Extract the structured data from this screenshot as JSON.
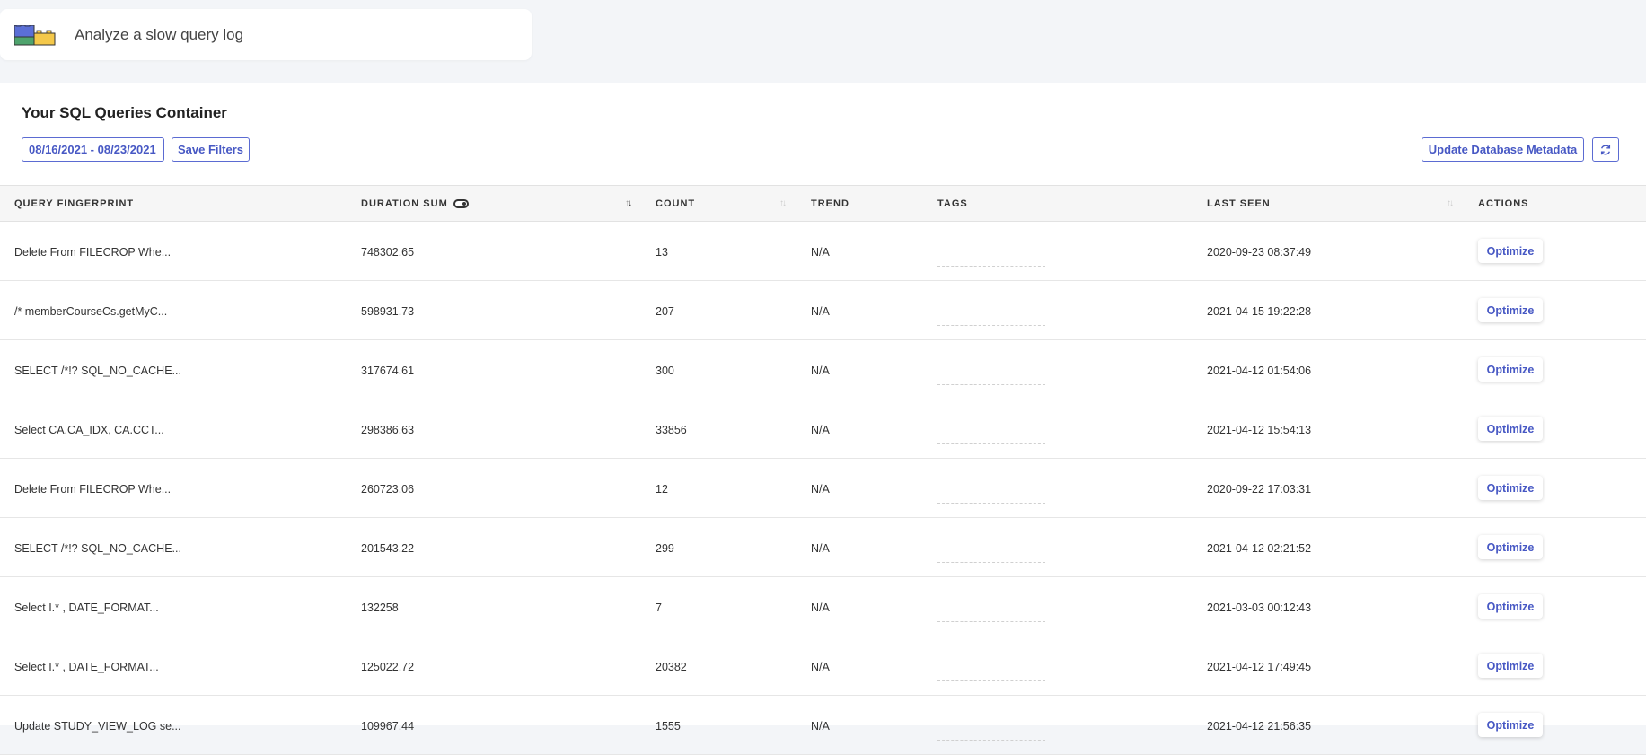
{
  "header": {
    "title": "Analyze a slow query log"
  },
  "container": {
    "title": "Your SQL Queries Container",
    "date_range": "08/16/2021 - 08/23/2021",
    "save_filters_label": "Save Filters",
    "update_metadata_label": "Update Database Metadata"
  },
  "table": {
    "columns": {
      "fingerprint": "QUERY FINGERPRINT",
      "duration": "DURATION SUM",
      "count": "COUNT",
      "trend": "TREND",
      "tags": "TAGS",
      "last_seen": "LAST SEEN",
      "actions": "ACTIONS"
    },
    "rows": [
      {
        "fingerprint": "Delete From FILECROP Whe...",
        "duration": "748302.65",
        "count": "13",
        "trend": "N/A",
        "last_seen": "2020-09-23 08:37:49",
        "action": "Optimize"
      },
      {
        "fingerprint": "/* memberCourseCs.getMyC...",
        "duration": "598931.73",
        "count": "207",
        "trend": "N/A",
        "last_seen": "2021-04-15 19:22:28",
        "action": "Optimize"
      },
      {
        "fingerprint": "SELECT /*!? SQL_NO_CACHE...",
        "duration": "317674.61",
        "count": "300",
        "trend": "N/A",
        "last_seen": "2021-04-12 01:54:06",
        "action": "Optimize"
      },
      {
        "fingerprint": "Select CA.CA_IDX, CA.CCT...",
        "duration": "298386.63",
        "count": "33856",
        "trend": "N/A",
        "last_seen": "2021-04-12 15:54:13",
        "action": "Optimize"
      },
      {
        "fingerprint": "Delete From FILECROP Whe...",
        "duration": "260723.06",
        "count": "12",
        "trend": "N/A",
        "last_seen": "2020-09-22 17:03:31",
        "action": "Optimize"
      },
      {
        "fingerprint": "SELECT /*!? SQL_NO_CACHE...",
        "duration": "201543.22",
        "count": "299",
        "trend": "N/A",
        "last_seen": "2021-04-12 02:21:52",
        "action": "Optimize"
      },
      {
        "fingerprint": "Select I.* , DATE_FORMAT...",
        "duration": "132258",
        "count": "7",
        "trend": "N/A",
        "last_seen": "2021-03-03 00:12:43",
        "action": "Optimize"
      },
      {
        "fingerprint": "Select I.* , DATE_FORMAT...",
        "duration": "125022.72",
        "count": "20382",
        "trend": "N/A",
        "last_seen": "2021-04-12 17:49:45",
        "action": "Optimize"
      },
      {
        "fingerprint": "Update STUDY_VIEW_LOG se...",
        "duration": "109967.44",
        "count": "1555",
        "trend": "N/A",
        "last_seen": "2021-04-12 21:56:35",
        "action": "Optimize"
      }
    ]
  },
  "icons": {
    "logo": "blocks-logo-icon",
    "toggle": "toggle-icon",
    "sort": "sort-icon",
    "refresh": "refresh-icon"
  },
  "colors": {
    "accent": "#4758c4",
    "header_bg": "#f6f6f6",
    "page_bg": "#f3f5f8"
  }
}
